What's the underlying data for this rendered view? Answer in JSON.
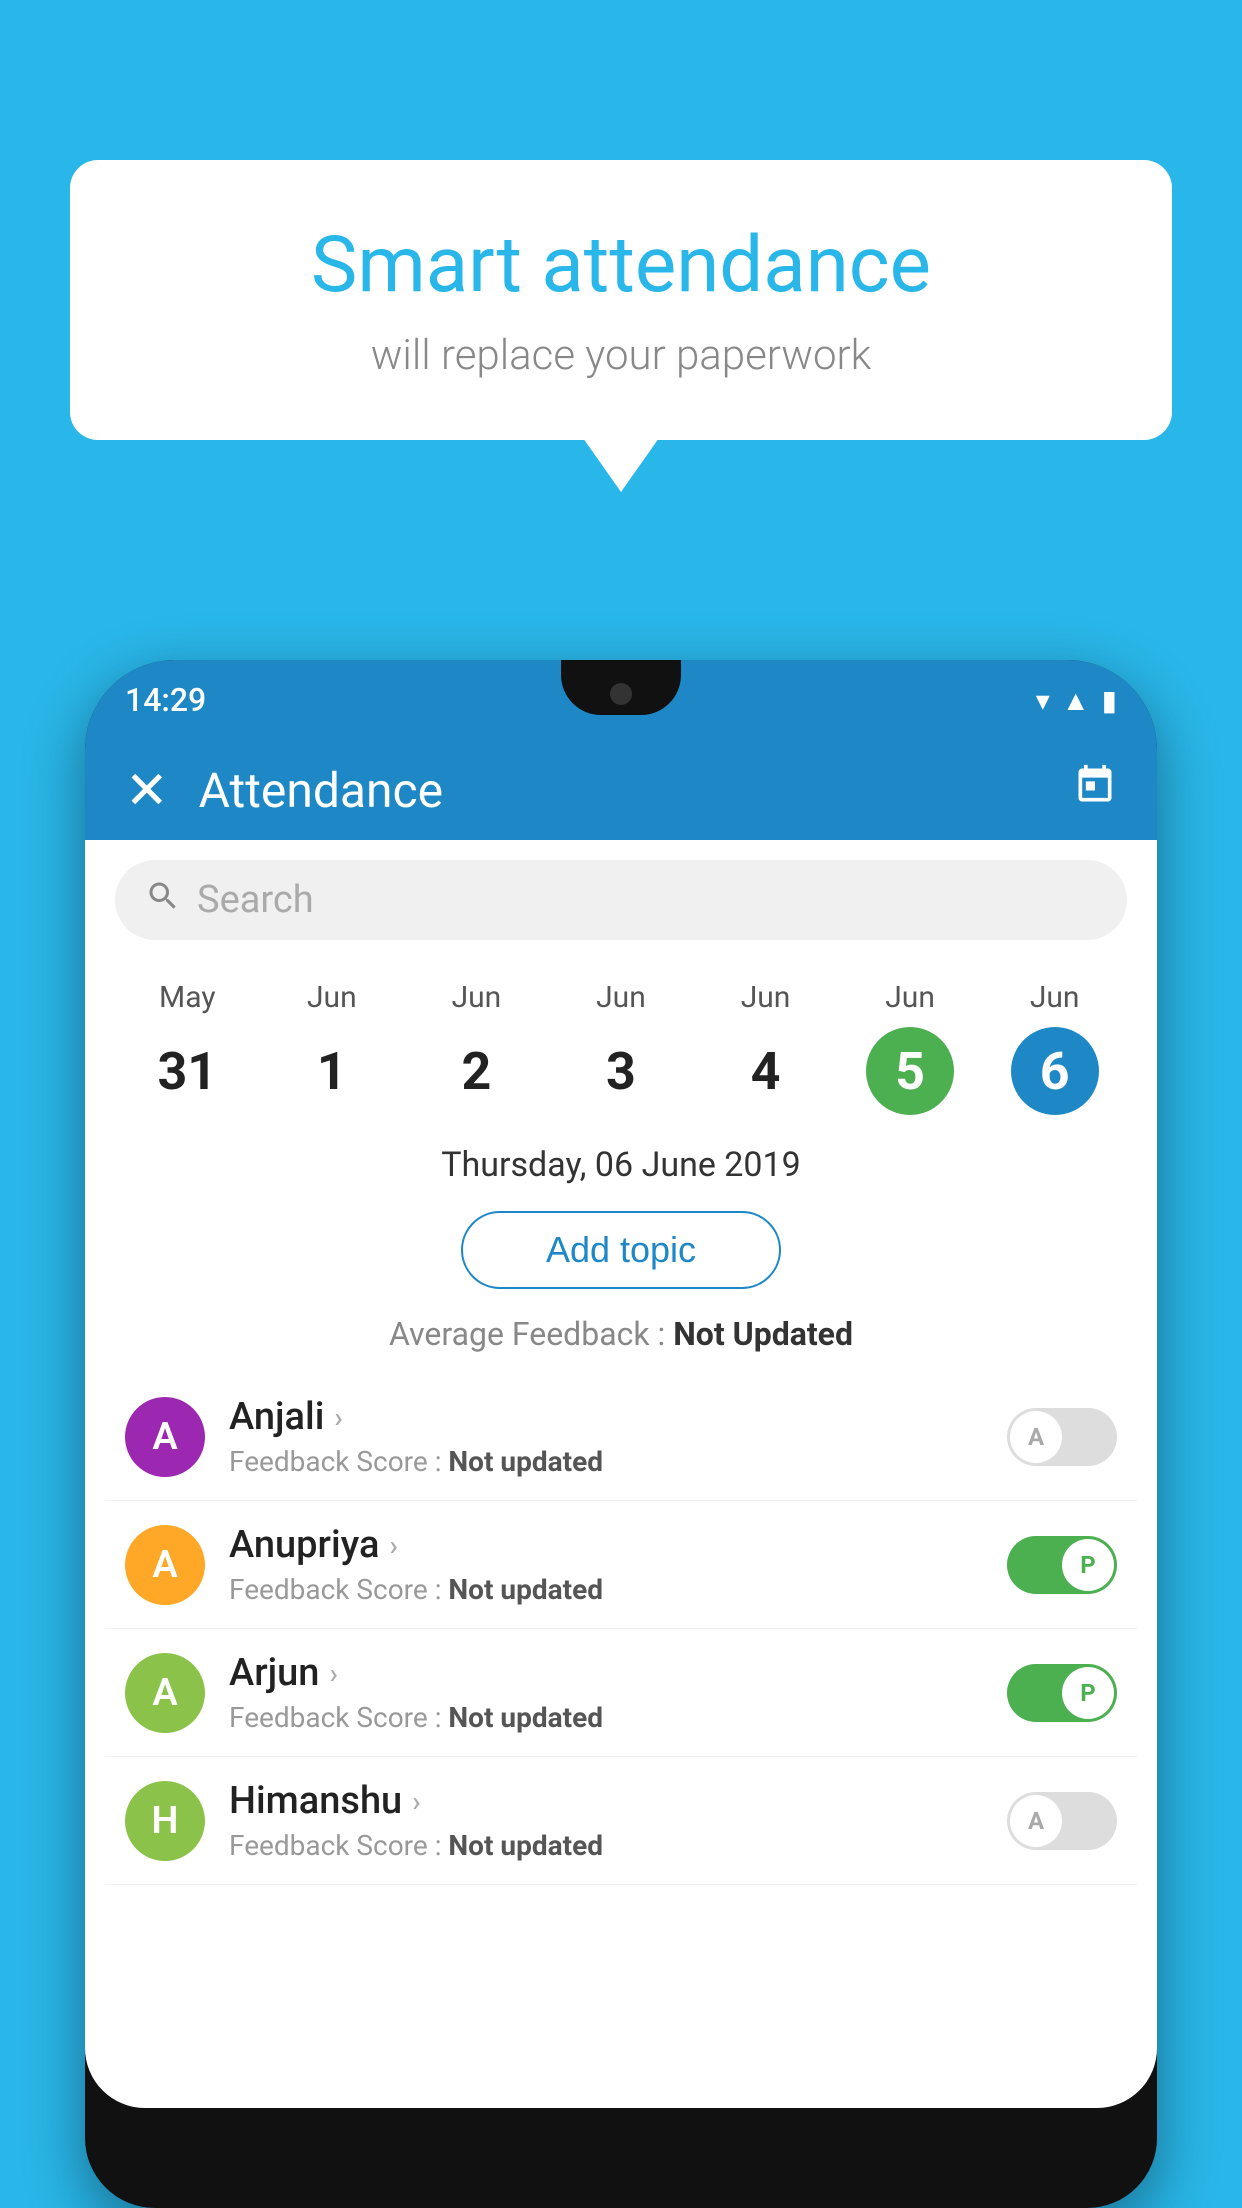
{
  "background_color": "#29b6e8",
  "speech_bubble": {
    "title": "Smart attendance",
    "subtitle": "will replace your paperwork"
  },
  "status_bar": {
    "time": "14:29",
    "icons": [
      "wifi",
      "signal",
      "battery"
    ]
  },
  "app_bar": {
    "title": "Attendance",
    "close_label": "✕",
    "calendar_icon": "📅"
  },
  "search": {
    "placeholder": "Search"
  },
  "calendar": {
    "days": [
      {
        "month": "May",
        "date": "31",
        "state": "normal"
      },
      {
        "month": "Jun",
        "date": "1",
        "state": "normal"
      },
      {
        "month": "Jun",
        "date": "2",
        "state": "normal"
      },
      {
        "month": "Jun",
        "date": "3",
        "state": "normal"
      },
      {
        "month": "Jun",
        "date": "4",
        "state": "normal"
      },
      {
        "month": "Jun",
        "date": "5",
        "state": "today"
      },
      {
        "month": "Jun",
        "date": "6",
        "state": "selected"
      }
    ],
    "selected_label": "Thursday, 06 June 2019"
  },
  "add_topic_label": "Add topic",
  "avg_feedback_prefix": "Average Feedback : ",
  "avg_feedback_value": "Not Updated",
  "students": [
    {
      "name": "Anjali",
      "initial": "A",
      "avatar_color": "#9c27b0",
      "score_prefix": "Feedback Score : ",
      "score": "Not updated",
      "toggle_state": "off",
      "toggle_label": "A"
    },
    {
      "name": "Anupriya",
      "initial": "A",
      "avatar_color": "#ffa726",
      "score_prefix": "Feedback Score : ",
      "score": "Not updated",
      "toggle_state": "on",
      "toggle_label": "P"
    },
    {
      "name": "Arjun",
      "initial": "A",
      "avatar_color": "#8bc34a",
      "score_prefix": "Feedback Score : ",
      "score": "Not updated",
      "toggle_state": "on",
      "toggle_label": "P"
    },
    {
      "name": "Himanshu",
      "initial": "H",
      "avatar_color": "#8bc34a",
      "score_prefix": "Feedback Score : ",
      "score": "Not updated",
      "toggle_state": "off",
      "toggle_label": "A"
    }
  ]
}
